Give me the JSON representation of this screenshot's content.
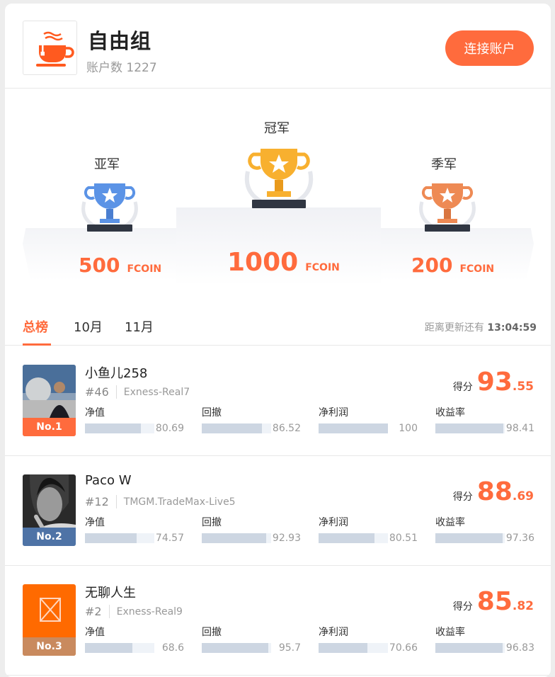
{
  "header": {
    "title": "自由组",
    "account_count": "账户数 1227",
    "connect_label": "连接账户"
  },
  "podium": {
    "second": {
      "label": "亚军",
      "amount": "500",
      "unit": "FCOIN",
      "trophy_color": "#5b93e6"
    },
    "first": {
      "label": "冠军",
      "amount": "1000",
      "unit": "FCOIN",
      "trophy_color": "#f8b02f"
    },
    "third": {
      "label": "季军",
      "amount": "200",
      "unit": "FCOIN",
      "trophy_color": "#ee8a54"
    }
  },
  "tabs": {
    "items": [
      "总榜",
      "10月",
      "11月"
    ],
    "active": "总榜",
    "update_prefix": "距离更新还有",
    "update_time": "13:04:59"
  },
  "colors": {
    "accent": "#ff6b3d"
  },
  "score_label": "得分",
  "metric_labels": [
    "净值",
    "回撤",
    "净利润",
    "收益率"
  ],
  "rows": [
    {
      "rank_badge": "No.1",
      "badge_color": "#ff6b3d",
      "name": "小鱼儿258",
      "rank": "#46",
      "server": "Exness-Real7",
      "score_int": "93",
      "score_dec": ".55",
      "metrics": [
        {
          "value": "80.69",
          "fill": 0.8069
        },
        {
          "value": "86.52",
          "fill": 0.8652
        },
        {
          "value": "100",
          "fill": 1.0
        },
        {
          "value": "98.41",
          "fill": 0.9841
        }
      ]
    },
    {
      "rank_badge": "No.2",
      "badge_color": "#4e73a6",
      "name": "Paco W",
      "rank": "#12",
      "server": "TMGM.TradeMax-Live5",
      "score_int": "88",
      "score_dec": ".69",
      "metrics": [
        {
          "value": "74.57",
          "fill": 0.7457
        },
        {
          "value": "92.93",
          "fill": 0.9293
        },
        {
          "value": "80.51",
          "fill": 0.8051
        },
        {
          "value": "97.36",
          "fill": 0.9736
        }
      ]
    },
    {
      "rank_badge": "No.3",
      "badge_color": "#c98a5e",
      "name": "无聊人生",
      "rank": "#2",
      "server": "Exness-Real9",
      "score_int": "85",
      "score_dec": ".82",
      "metrics": [
        {
          "value": "68.6",
          "fill": 0.686
        },
        {
          "value": "95.7",
          "fill": 0.957
        },
        {
          "value": "70.66",
          "fill": 0.7066
        },
        {
          "value": "96.83",
          "fill": 0.9683
        }
      ]
    }
  ]
}
